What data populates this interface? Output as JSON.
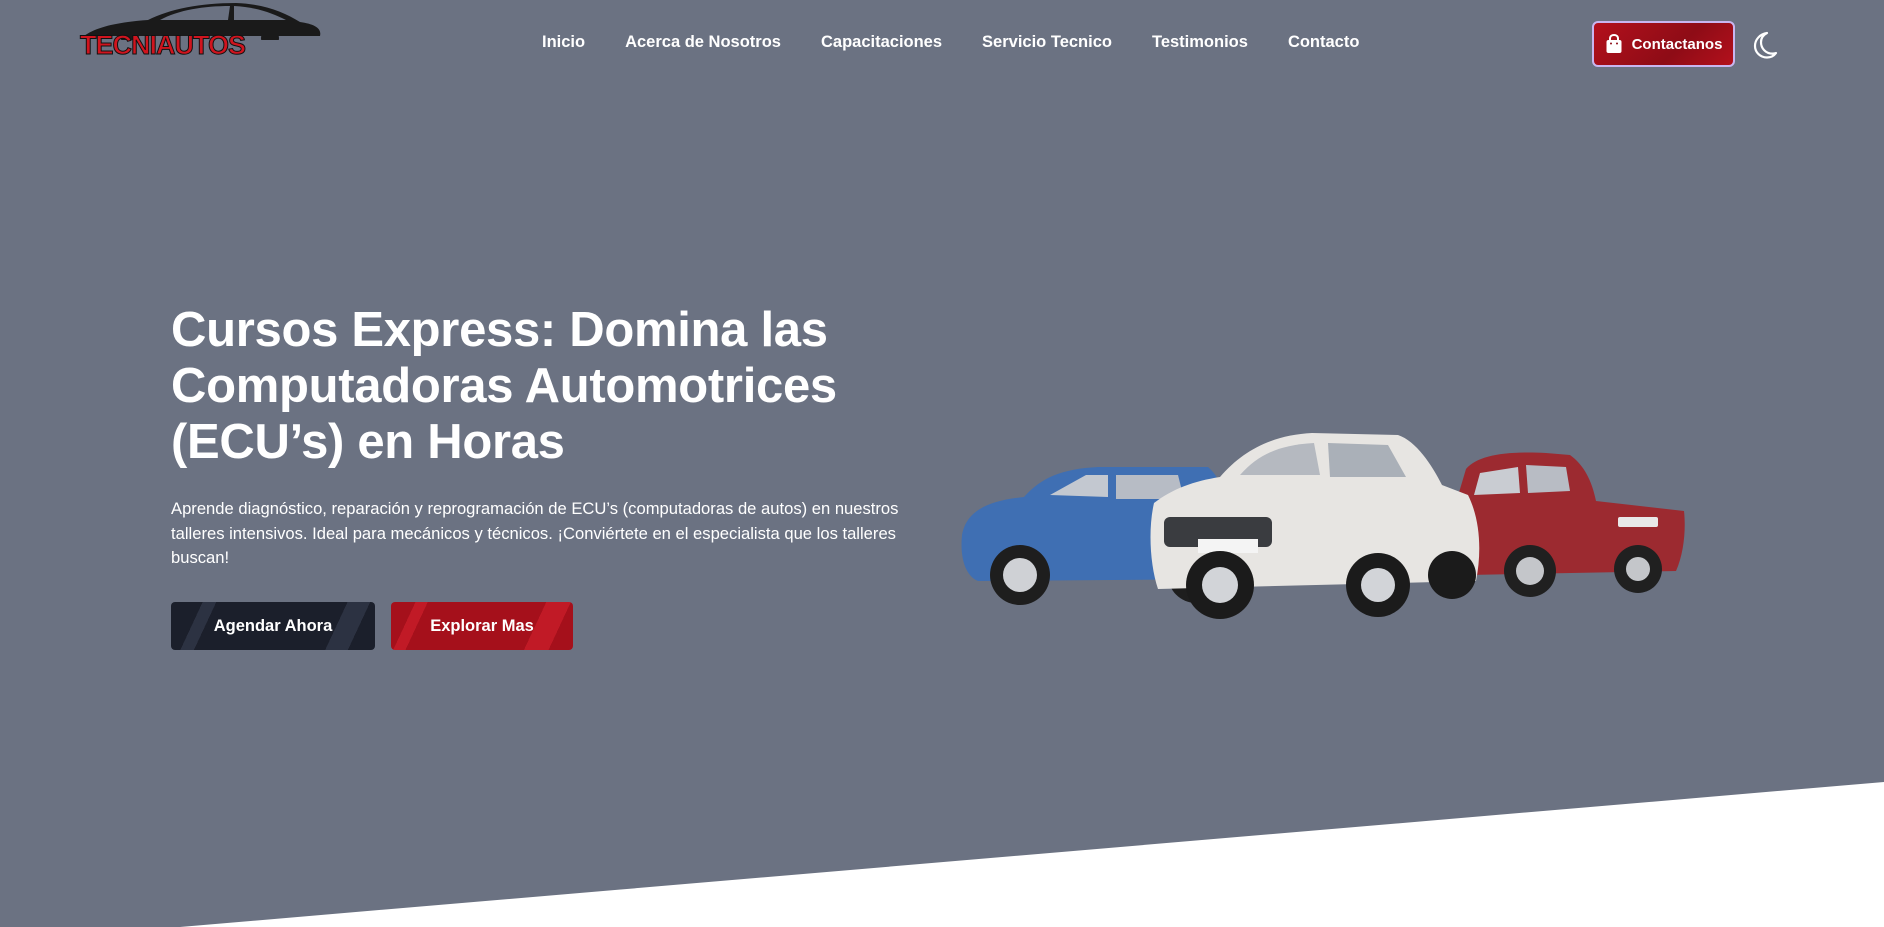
{
  "brand": {
    "logo_text": "TECNIAUTOS"
  },
  "nav": {
    "items": [
      {
        "label": "Inicio"
      },
      {
        "label": "Acerca de Nosotros"
      },
      {
        "label": "Capacitaciones"
      },
      {
        "label": "Servicio Tecnico"
      },
      {
        "label": "Testimonios"
      },
      {
        "label": "Contacto"
      }
    ]
  },
  "header": {
    "contact_label": "Contactanos"
  },
  "hero": {
    "title": "Cursos Express: Domina las Computadoras Automotrices (ECU’s) en Horas",
    "description": "Aprende diagnóstico, reparación y reprogramación de ECU’s (computadoras de autos) en nuestros talleres intensivos. Ideal para mecánicos y técnicos. ¡Conviértete en el especialista que los talleres buscan!",
    "primary_cta": "Agendar Ahora",
    "secondary_cta": "Explorar Mas"
  },
  "colors": {
    "background": "#6b7282",
    "accent_red": "#a5101b",
    "dark_button": "#1b1f2b",
    "white": "#ffffff"
  },
  "icons": {
    "contact": "shopping-bag-icon",
    "theme": "moon-icon"
  }
}
